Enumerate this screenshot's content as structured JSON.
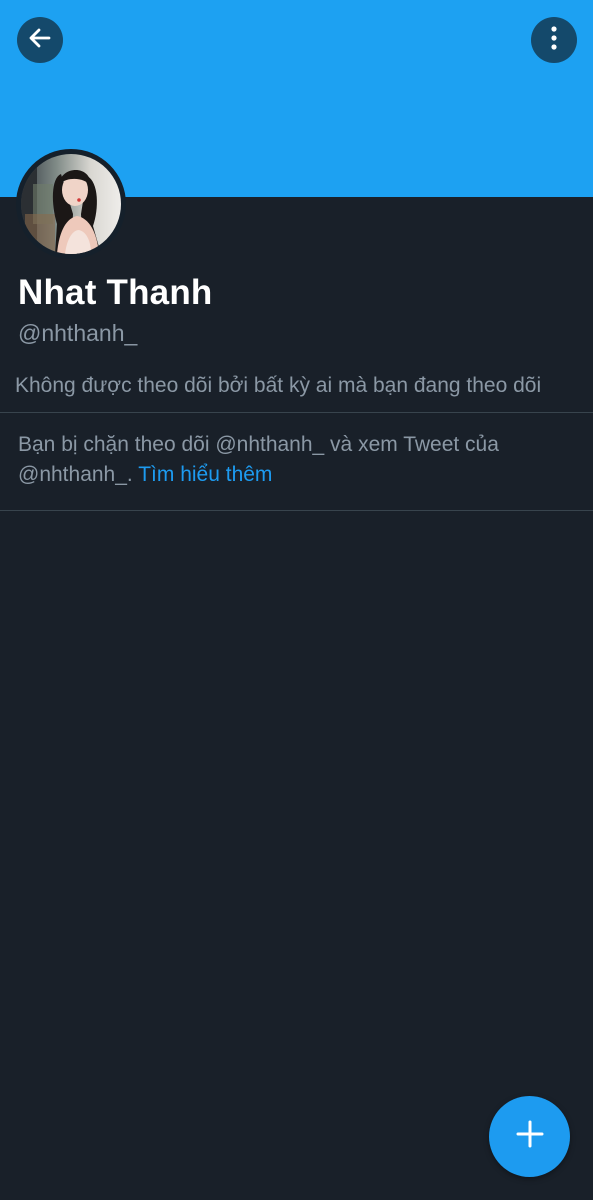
{
  "profile": {
    "display_name": "Nhat Thanh",
    "handle": "@nhthanh_",
    "follow_context": "Không được theo dõi bởi bất kỳ ai mà bạn đang theo dõi"
  },
  "blocked_notice": {
    "text": "Bạn bị chặn theo dõi @nhthanh_ và xem Tweet của @nhthanh_. ",
    "link_label": "Tìm hiểu thêm"
  },
  "icons": {
    "back": "arrow-left-icon",
    "menu": "more-vertical-icon",
    "compose": "plus-icon"
  },
  "colors": {
    "banner": "#1da1f2",
    "background": "#192029",
    "text_primary": "#ffffff",
    "text_secondary": "#8b98a5",
    "accent": "#1d9bf0",
    "divider": "#38444d"
  }
}
